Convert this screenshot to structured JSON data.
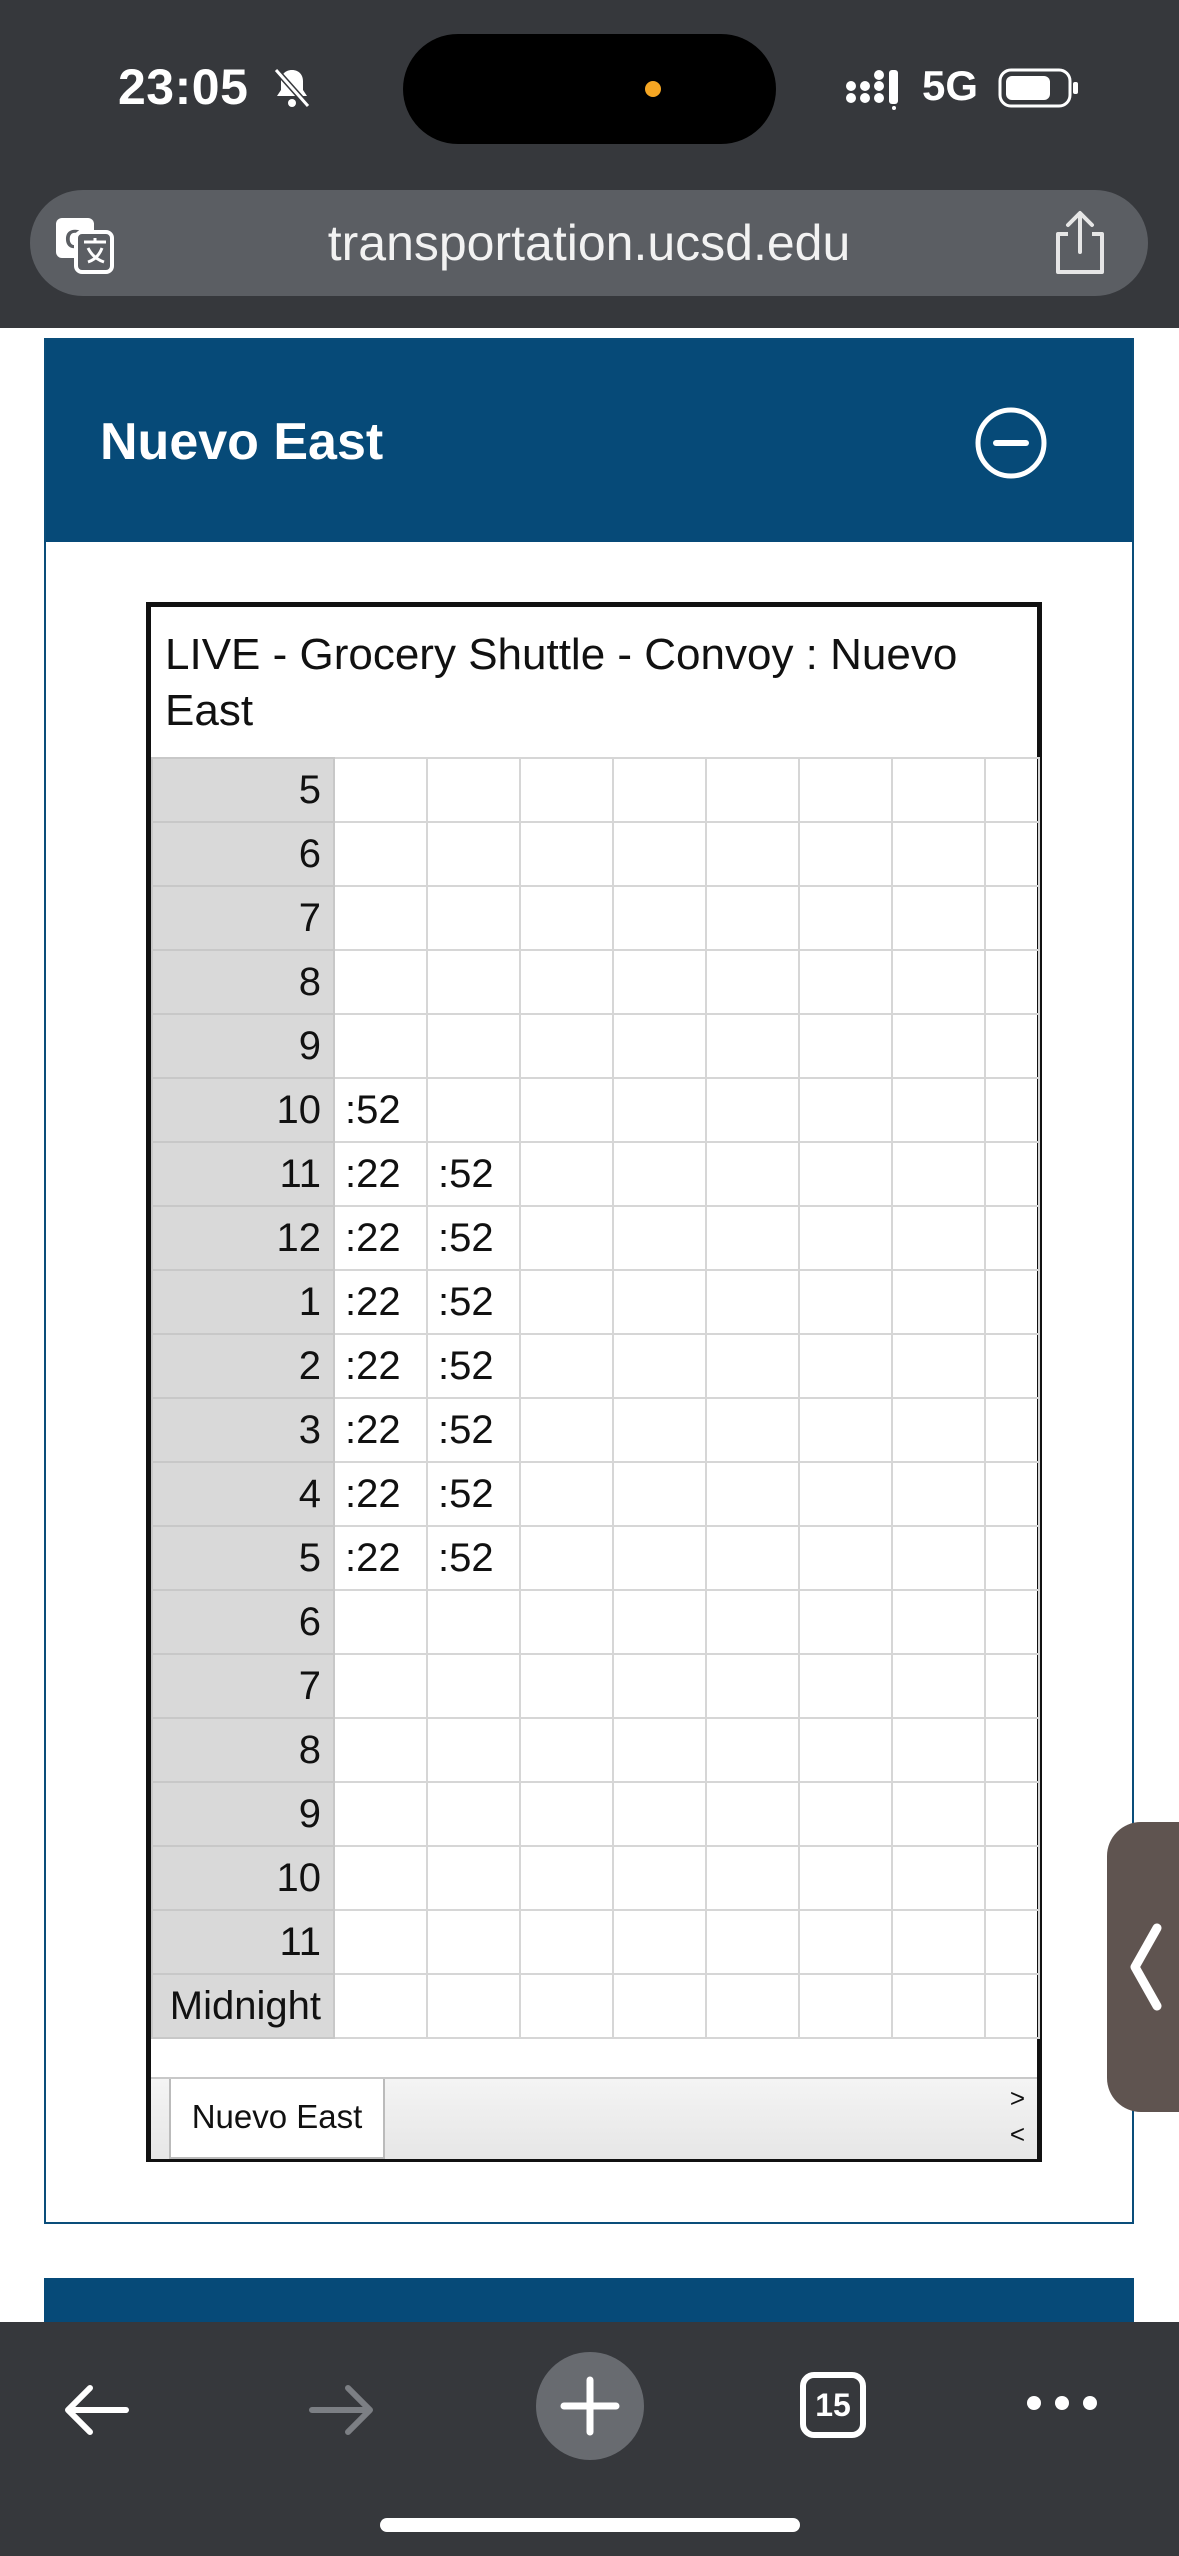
{
  "status_bar": {
    "time": "23:05",
    "network": "5G",
    "icons": [
      "bell-slash-icon",
      "signal-icon",
      "battery-icon"
    ]
  },
  "browser": {
    "url": "transportation.ucsd.edu",
    "tab_count": "15",
    "icons": [
      "translate-icon",
      "share-icon",
      "back-arrow-icon",
      "forward-arrow-icon",
      "plus-icon",
      "tabs-icon",
      "more-icon"
    ]
  },
  "section": {
    "title": "Nuevo East",
    "toggle_icon": "minus-circle-icon"
  },
  "schedule": {
    "title": "LIVE - Grocery Shuttle - Convoy : Nuevo East",
    "rows": [
      {
        "hour": "5",
        "times": [
          "",
          ""
        ]
      },
      {
        "hour": "6",
        "times": [
          "",
          ""
        ]
      },
      {
        "hour": "7",
        "times": [
          "",
          ""
        ]
      },
      {
        "hour": "8",
        "times": [
          "",
          ""
        ]
      },
      {
        "hour": "9",
        "times": [
          "",
          ""
        ]
      },
      {
        "hour": "10",
        "times": [
          ":52",
          ""
        ]
      },
      {
        "hour": "11",
        "times": [
          ":22",
          ":52"
        ]
      },
      {
        "hour": "12",
        "times": [
          ":22",
          ":52"
        ]
      },
      {
        "hour": "1",
        "times": [
          ":22",
          ":52"
        ]
      },
      {
        "hour": "2",
        "times": [
          ":22",
          ":52"
        ]
      },
      {
        "hour": "3",
        "times": [
          ":22",
          ":52"
        ]
      },
      {
        "hour": "4",
        "times": [
          ":22",
          ":52"
        ]
      },
      {
        "hour": "5",
        "times": [
          ":22",
          ":52"
        ]
      },
      {
        "hour": "6",
        "times": [
          "",
          ""
        ]
      },
      {
        "hour": "7",
        "times": [
          "",
          ""
        ]
      },
      {
        "hour": "8",
        "times": [
          "",
          ""
        ]
      },
      {
        "hour": "9",
        "times": [
          "",
          ""
        ]
      },
      {
        "hour": "10",
        "times": [
          "",
          ""
        ]
      },
      {
        "hour": "11",
        "times": [
          "",
          ""
        ]
      },
      {
        "hour": "Midnight",
        "times": [
          "",
          ""
        ]
      }
    ],
    "sheet_tab": "Nuevo East",
    "nav_next": ">",
    "nav_prev": "<"
  },
  "colors": {
    "header_blue": "#064a78",
    "chrome_dark": "#36383c",
    "hour_cell": "#d9d9d9"
  }
}
